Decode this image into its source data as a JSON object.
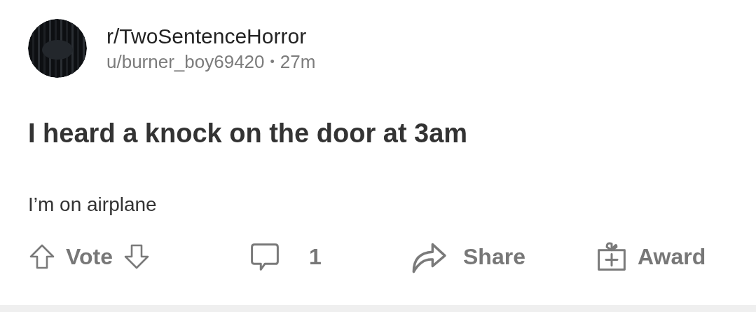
{
  "post": {
    "subreddit": "r/TwoSentenceHorror",
    "author": "u/burner_boy69420",
    "separator": "•",
    "age": "27m",
    "title": "I heard a knock on the door at 3am",
    "body": "I’m on airplane"
  },
  "actions": {
    "vote_label": "Vote",
    "comment_count": "1",
    "share_label": "Share",
    "award_label": "Award"
  }
}
